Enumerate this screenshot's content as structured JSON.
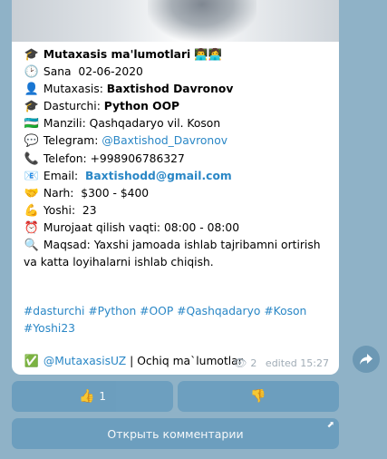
{
  "post": {
    "lines": {
      "title": {
        "icon": "🎓",
        "text": "Mutaxasis ma'lumotlari",
        "tail": "👨‍💻👩‍💻"
      },
      "date": {
        "icon": "🕑",
        "label": "Sana",
        "value": "02-06-2020"
      },
      "specialist": {
        "icon": "👤",
        "label": "Mutaxasis:",
        "value": "Baxtishod Davronov"
      },
      "programmer": {
        "icon": "🎓",
        "label": "Dasturchi:",
        "value": "Python OOP"
      },
      "address": {
        "icon": "🇺🇿",
        "label": "Manzili:",
        "value": "Qashqadaryo vil. Koson"
      },
      "telegram": {
        "icon": "💬",
        "label": "Telegram:",
        "value": "@Baxtishod_Davronov"
      },
      "phone": {
        "icon": "📞",
        "label": "Telefon:",
        "value": "+998906786327"
      },
      "email": {
        "icon": "📧",
        "label": "Email:",
        "value": "Baxtishodd@gmail.com"
      },
      "price": {
        "icon": "🤝",
        "label": "Narh:",
        "value": "$300 - $400"
      },
      "age": {
        "icon": "💪",
        "label": "Yoshi:",
        "value": "23"
      },
      "contact_time": {
        "icon": "⏰",
        "label": "Murojaat qilish vaqti:",
        "value": "08:00 - 08:00"
      },
      "goal": {
        "icon": "🔍",
        "label": "Maqsad:",
        "value": "Yaxshi jamoada ishlab tajribamni ortirish va katta loyihalarni ishlab chiqish."
      }
    },
    "hashtags_line1": "#dasturchi #Python #OOP #Qashqadaryo #Koson",
    "hashtags_line2": "#Yoshi23",
    "footer": {
      "icon": "✅",
      "channel": "@MutaxasisUZ",
      "separator": " | ",
      "text": "Ochiq ma`lumotlar"
    },
    "meta": {
      "views": "2",
      "edited": "edited 15:27"
    }
  },
  "reactions": {
    "like": {
      "icon": "👍",
      "count": "1"
    },
    "dislike": {
      "icon": "👎"
    }
  },
  "comments_button": "Открыть комментарии",
  "colors": {
    "background": "#8fb2c7",
    "link": "#2a87c6",
    "button": "#6a9dbe"
  }
}
